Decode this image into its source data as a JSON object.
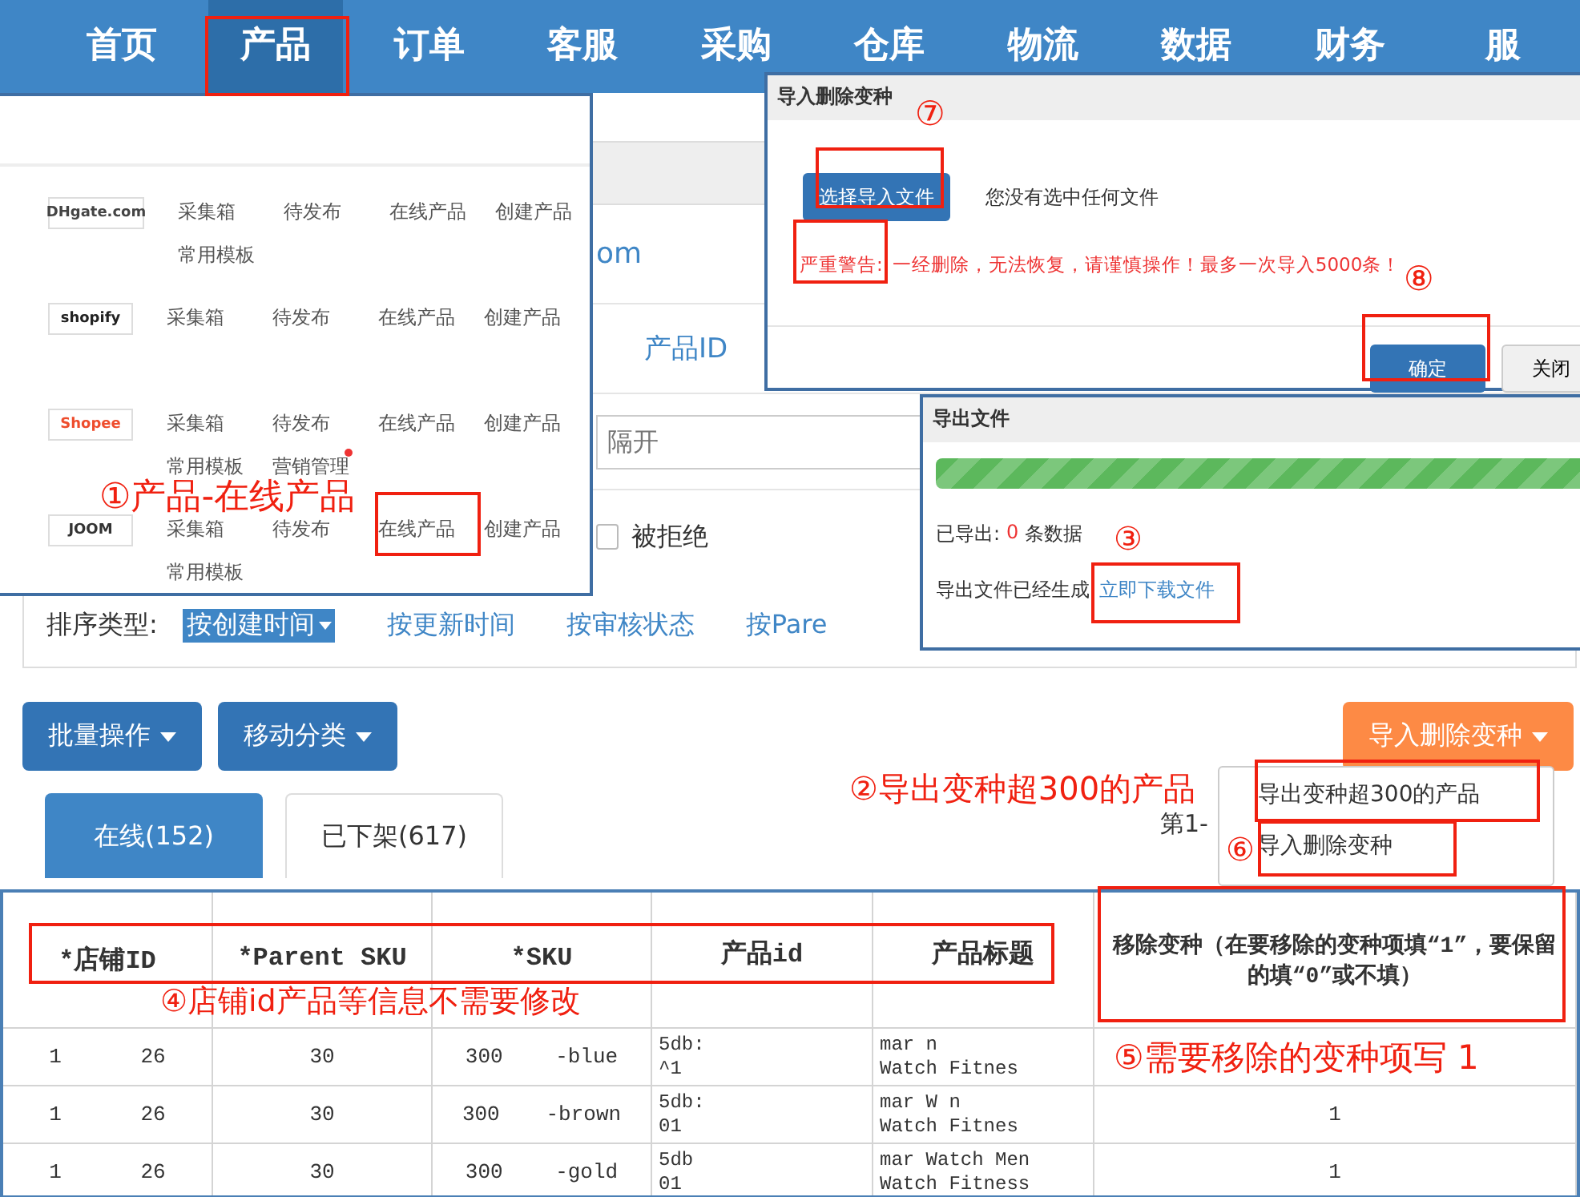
{
  "nav": [
    {
      "label": "首页",
      "selected": false
    },
    {
      "label": "产品",
      "selected": true
    },
    {
      "label": "订单",
      "selected": false
    },
    {
      "label": "客服",
      "selected": false
    },
    {
      "label": "采购",
      "selected": false
    },
    {
      "label": "仓库",
      "selected": false
    },
    {
      "label": "物流",
      "selected": false
    },
    {
      "label": "数据",
      "selected": false
    },
    {
      "label": "财务",
      "selected": false
    },
    {
      "label": "服",
      "selected": false
    }
  ],
  "product_menu": [
    {
      "logo": {
        "text": "DHgate.com",
        "color": "#444444"
      },
      "links": [
        {
          "label": "采集箱",
          "notice": false
        },
        {
          "label": "待发布",
          "notice": false
        },
        {
          "label": "在线产品",
          "notice": false
        },
        {
          "label": "创建产品",
          "notice": false
        },
        {
          "label": "常用模板",
          "notice": false
        }
      ]
    },
    {
      "logo": {
        "text": "shopify",
        "color": "#222222"
      },
      "links": [
        {
          "label": "采集箱",
          "notice": false
        },
        {
          "label": "待发布",
          "notice": false
        },
        {
          "label": "在线产品",
          "notice": false
        },
        {
          "label": "创建产品",
          "notice": false
        }
      ]
    },
    {
      "logo": {
        "text": "Shopee",
        "color": "#ee4d2d"
      },
      "links": [
        {
          "label": "采集箱",
          "notice": false
        },
        {
          "label": "待发布",
          "notice": false
        },
        {
          "label": "在线产品",
          "notice": false
        },
        {
          "label": "创建产品",
          "notice": false
        },
        {
          "label": "常用模板",
          "notice": false
        },
        {
          "label": "营销管理",
          "notice": true
        }
      ]
    },
    {
      "logo": {
        "text": "JOOM",
        "color": "#333333"
      },
      "links": [
        {
          "label": "采集箱",
          "notice": false
        },
        {
          "label": "待发布",
          "notice": false
        },
        {
          "label": "在线产品",
          "notice": false
        },
        {
          "label": "创建产品",
          "notice": false
        },
        {
          "label": "常用模板",
          "notice": false
        }
      ]
    }
  ],
  "filters": {
    "fragment": "om",
    "field_label": "产品ID",
    "search_placeholder": "隔开",
    "checkbox": {
      "label": "被拒绝",
      "checked": false
    },
    "sort_label": "排序类型:",
    "sort_options": [
      {
        "label": "按创建时间",
        "selected": true
      },
      {
        "label": "按更新时间",
        "selected": false
      },
      {
        "label": "按审核状态",
        "selected": false
      },
      {
        "label": "按Pare",
        "selected": false
      }
    ]
  },
  "toolbar": {
    "buttons": [
      {
        "label": "批量操作",
        "kind": "primary"
      },
      {
        "label": "移动分类",
        "kind": "primary"
      },
      {
        "label": "导入删除变种",
        "kind": "warning"
      }
    ],
    "dropdown": [
      "导出变种超300的产品",
      "导入删除变种"
    ]
  },
  "tabs": [
    {
      "label": "在线(152)",
      "selected": true
    },
    {
      "label": "已下架(617)",
      "selected": false
    }
  ],
  "pagination": "第1-",
  "import_dialog": {
    "title": "导入删除变种",
    "choose_button": "选择导入文件",
    "file_status": "您没有选中任何文件",
    "warning_label": "严重警告:",
    "warning_text": "一经删除，无法恢复，请谨慎操作！最多一次导入5000条！",
    "buttons": [
      {
        "label": "确定",
        "kind": "primary"
      },
      {
        "label": "关闭",
        "kind": "default"
      }
    ]
  },
  "export_dialog": {
    "title": "导出文件",
    "progress": {
      "level": 1
    },
    "exported_label": "已导出:",
    "exported_count": "0",
    "exported_unit": "条数据",
    "ready_text": "导出文件已经生成",
    "download_link": "立即下载文件"
  },
  "spreadsheet": {
    "columns": [
      "*店铺ID",
      "*Parent SKU",
      "*SKU",
      "产品id",
      "产品标题",
      "移除变种（在要移除的变种项填“1”，要保留的填“0”或不填）"
    ],
    "rows": [
      {
        "cells": [
          [
            "1",
            "26"
          ],
          [
            "30"
          ],
          [
            "300",
            "-blue"
          ],
          [
            "5db:",
            "^1"
          ],
          [
            "mar n",
            "Watch Fitnes"
          ],
          []
        ]
      },
      {
        "cells": [
          [
            "1",
            "26"
          ],
          [
            "30"
          ],
          [
            "300",
            "-brown"
          ],
          [
            "5db:",
            "01"
          ],
          [
            "mar W n",
            "Watch Fitnes"
          ],
          [
            "1"
          ]
        ]
      },
      {
        "cells": [
          [
            "1",
            "26"
          ],
          [
            "30"
          ],
          [
            "300",
            "-gold"
          ],
          [
            "5db",
            "01"
          ],
          [
            "mar Watch Men",
            "Watch Fitness"
          ],
          [
            "1"
          ]
        ]
      }
    ]
  },
  "annotations": [
    {
      "text": "①产品-在线产品"
    },
    {
      "text": "②导出变种超300的产品"
    },
    {
      "text": "③"
    },
    {
      "text": "④店铺id产品等信息不需要修改"
    },
    {
      "text": "⑤需要移除的变种项写 1"
    },
    {
      "text": "⑥"
    },
    {
      "text": "⑦"
    },
    {
      "text": "⑧"
    }
  ]
}
